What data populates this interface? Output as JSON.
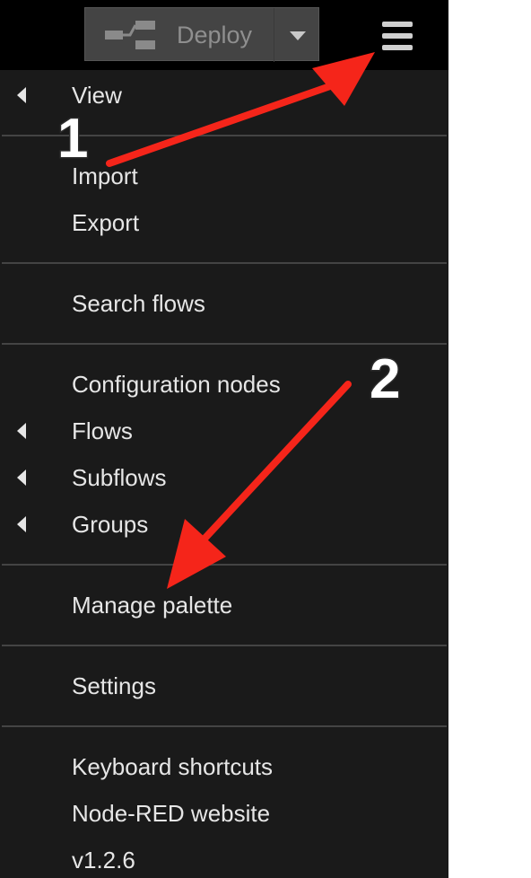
{
  "header": {
    "deploy_label": "Deploy"
  },
  "menu": {
    "view": "View",
    "import": "Import",
    "export": "Export",
    "search_flows": "Search flows",
    "configuration_nodes": "Configuration nodes",
    "flows": "Flows",
    "subflows": "Subflows",
    "groups": "Groups",
    "manage_palette": "Manage palette",
    "settings": "Settings",
    "keyboard_shortcuts": "Keyboard shortcuts",
    "node_red_website": "Node-RED website",
    "version": "v1.2.6"
  },
  "annotations": {
    "step1": "1",
    "step2": "2",
    "arrow_color": "#f5251a"
  },
  "colors": {
    "header_bg": "#000000",
    "menu_bg": "#1a1a1a",
    "menu_text": "#e6e6e6",
    "deploy_bg": "#444444"
  }
}
